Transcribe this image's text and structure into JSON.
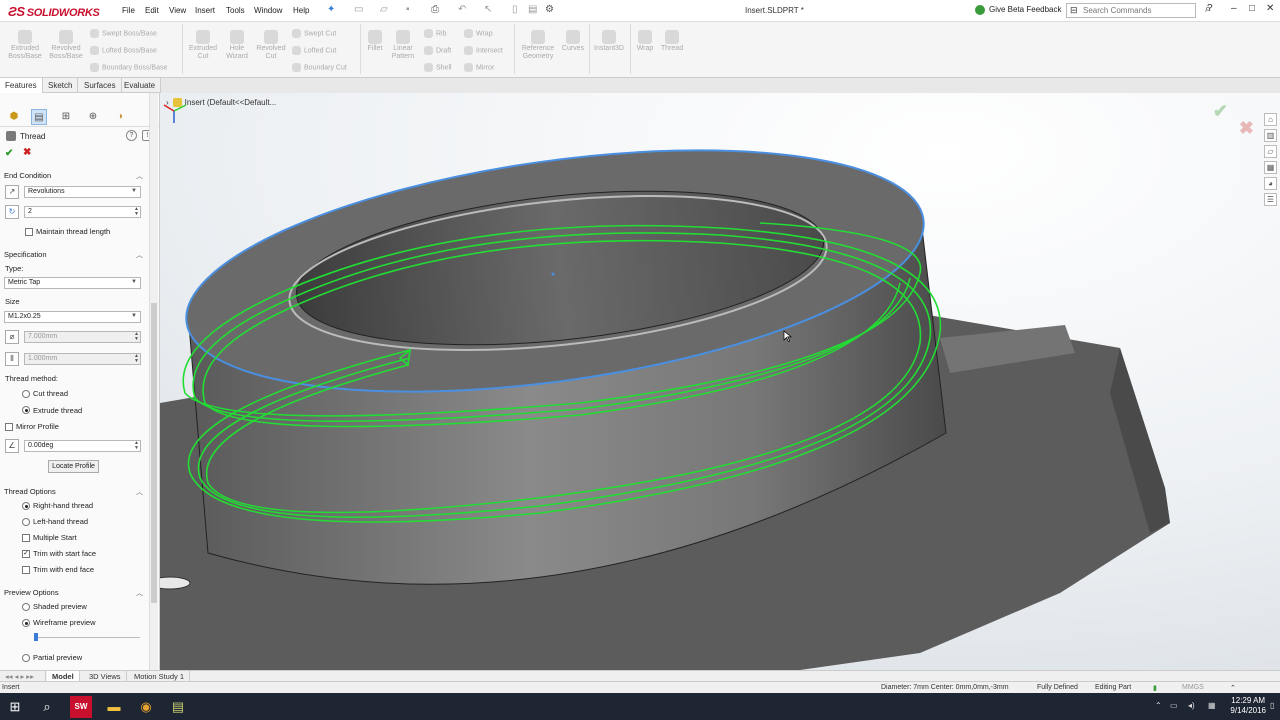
{
  "app": {
    "name": "SOLIDWORKS",
    "doc_title": "Insert.SLDPRT *"
  },
  "menu": [
    "File",
    "Edit",
    "View",
    "Insert",
    "Tools",
    "Window",
    "Help"
  ],
  "beta_feedback": "Give Beta Feedback",
  "search": {
    "placeholder": "Search Commands"
  },
  "commands": {
    "extruded_boss": "Extruded Boss/Base",
    "revolved_boss": "Revolved Boss/Base",
    "swept_boss": "Swept Boss/Base",
    "lofted_boss": "Lofted Boss/Base",
    "boundary_boss": "Boundary Boss/Base",
    "extruded_cut": "Extruded Cut",
    "hole_wizard": "Hole Wizard",
    "revolved_cut": "Revolved Cut",
    "swept_cut": "Swept Cut",
    "lofted_cut": "Lofted Cut",
    "boundary_cut": "Boundary Cut",
    "fillet": "Fillet",
    "linear_pattern": "Linear Pattern",
    "rib": "Rib",
    "draft": "Draft",
    "shell": "Shell",
    "wrap": "Wrap",
    "intersect": "Intersect",
    "mirror": "Mirror",
    "reference_geometry": "Reference Geometry",
    "curves": "Curves",
    "instant3d": "Instant3D",
    "wrap2": "Wrap",
    "thread": "Thread"
  },
  "tabs": [
    "Features",
    "Sketch",
    "Surfaces",
    "Evaluate"
  ],
  "property_manager": {
    "title": "Thread",
    "end_condition": {
      "header": "End Condition",
      "type": "Revolutions",
      "revolutions": "2",
      "maintain_length": "Maintain thread length"
    },
    "specification": {
      "header": "Specification",
      "type_label": "Type:",
      "type": "Metric Tap",
      "size_label": "Size",
      "size": "M1.2x0.25",
      "diameter": "7.000mm",
      "pitch": "1.000mm",
      "method_label": "Thread method:",
      "cut_thread": "Cut thread",
      "extrude_thread": "Extrude thread",
      "mirror_profile": "Mirror Profile",
      "angle": "0.00deg",
      "locate_profile": "Locate Profile"
    },
    "thread_options": {
      "header": "Thread Options",
      "right_hand": "Right-hand thread",
      "left_hand": "Left-hand thread",
      "multiple_start": "Multiple Start",
      "trim_start": "Trim with start face",
      "trim_end": "Trim with end face"
    },
    "preview_options": {
      "header": "Preview Options",
      "shaded": "Shaded preview",
      "wireframe": "Wireframe preview",
      "partial": "Partial preview"
    }
  },
  "tree_label": "Insert  (Default<<Default...",
  "bottom_tabs": [
    "Model",
    "3D Views",
    "Motion Study 1"
  ],
  "status": {
    "left": "Insert",
    "measure": "Diameter: 7mm  Center: 0mm,0mm,-3mm",
    "defined": "Fully Defined",
    "mode": "Editing Part",
    "units": "MMGS"
  },
  "clock": {
    "time": "12:29 AM",
    "date": "9/14/2016"
  },
  "colors": {
    "accent": "#c8102e",
    "preview_green": "#22dd33",
    "edge_blue": "#4a8fe0"
  }
}
